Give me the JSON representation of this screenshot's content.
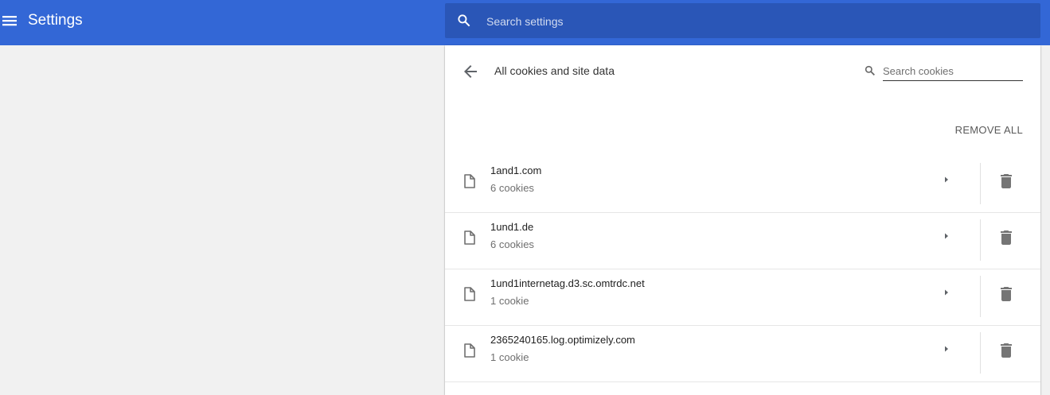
{
  "header": {
    "title": "Settings",
    "search_placeholder": "Search settings",
    "menu_icon": "hamburger-menu-icon",
    "search_icon": "search-icon",
    "accent_color": "#3367d6"
  },
  "panel": {
    "title": "All cookies and site data",
    "back_icon": "arrow-back-icon",
    "search_placeholder": "Search cookies",
    "remove_all_label": "REMOVE ALL"
  },
  "sites": [
    {
      "name": "1and1.com",
      "count": "6 cookies"
    },
    {
      "name": "1und1.de",
      "count": "6 cookies"
    },
    {
      "name": "1und1internetag.d3.sc.omtrdc.net",
      "count": "1 cookie"
    },
    {
      "name": "2365240165.log.optimizely.com",
      "count": "1 cookie"
    }
  ]
}
